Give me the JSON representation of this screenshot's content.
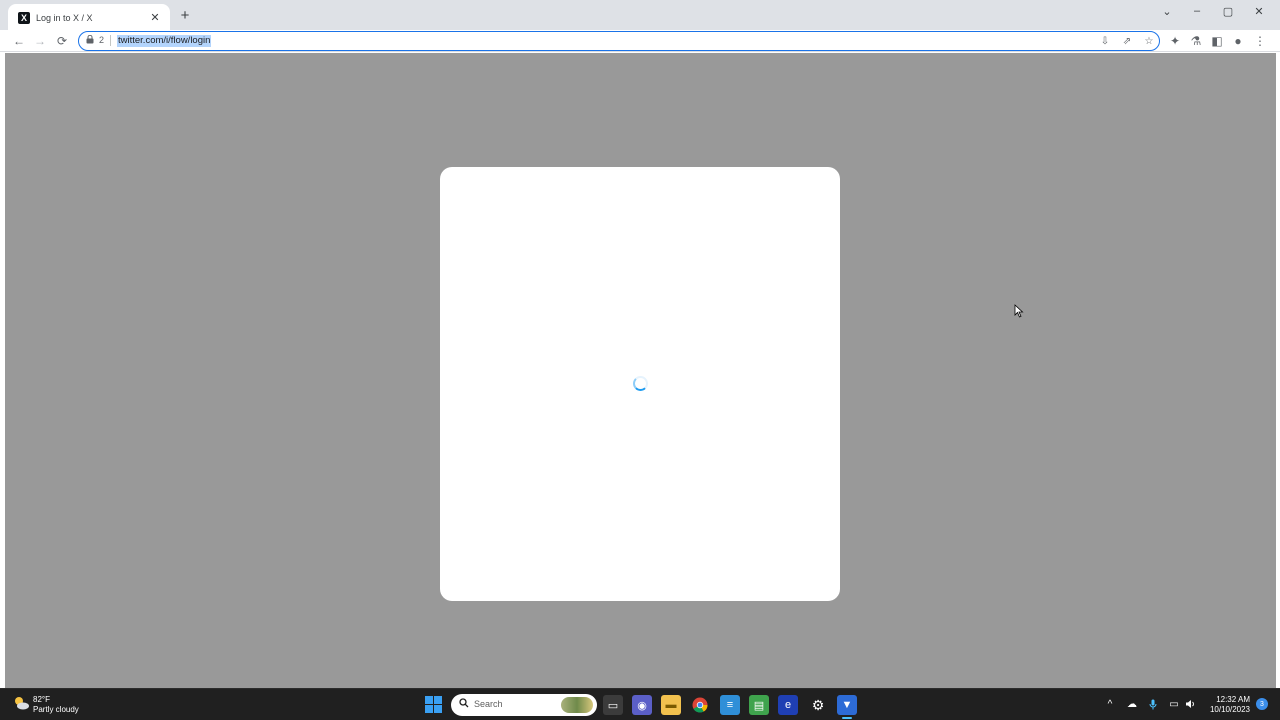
{
  "browser": {
    "tab": {
      "title": "Log in to X / X",
      "favicon": "x-logo",
      "close": "✕"
    },
    "new_tab": "+",
    "window_controls": {
      "tab_search": "⌄",
      "minimize": "–",
      "maximize": "▢",
      "close": "✕"
    },
    "toolbar": {
      "back": "←",
      "forward": "→",
      "reload": "⟳"
    },
    "omnibox": {
      "lock": "🔒",
      "badge": "2",
      "url": "twitter.com/i/flow/login",
      "icons": [
        "install-icon",
        "share-icon",
        "star-icon"
      ]
    },
    "extras": {
      "extensions": "✦",
      "labs": "⚗",
      "side_panel": "◧",
      "profile": "●",
      "menu": "⋮"
    }
  },
  "page": {
    "overlay_color": "#999999",
    "modal_color": "#ffffff",
    "spinner_color": "#1d9bf0"
  },
  "taskbar": {
    "weather": {
      "temp": "82°F",
      "desc": "Partly cloudy"
    },
    "search": {
      "placeholder": "Search"
    },
    "apps": [
      "task-view",
      "teams",
      "file-explorer",
      "chrome",
      "notepad",
      "excel-like",
      "edge-like",
      "settings",
      "vpn"
    ],
    "tray": {
      "chevron": "^",
      "onedrive": "☁",
      "mic": "🎤",
      "network": "▭",
      "volume": "🔊"
    },
    "clock": {
      "time": "12:32 AM",
      "date": "10/10/2023"
    },
    "notification_count": "3"
  }
}
